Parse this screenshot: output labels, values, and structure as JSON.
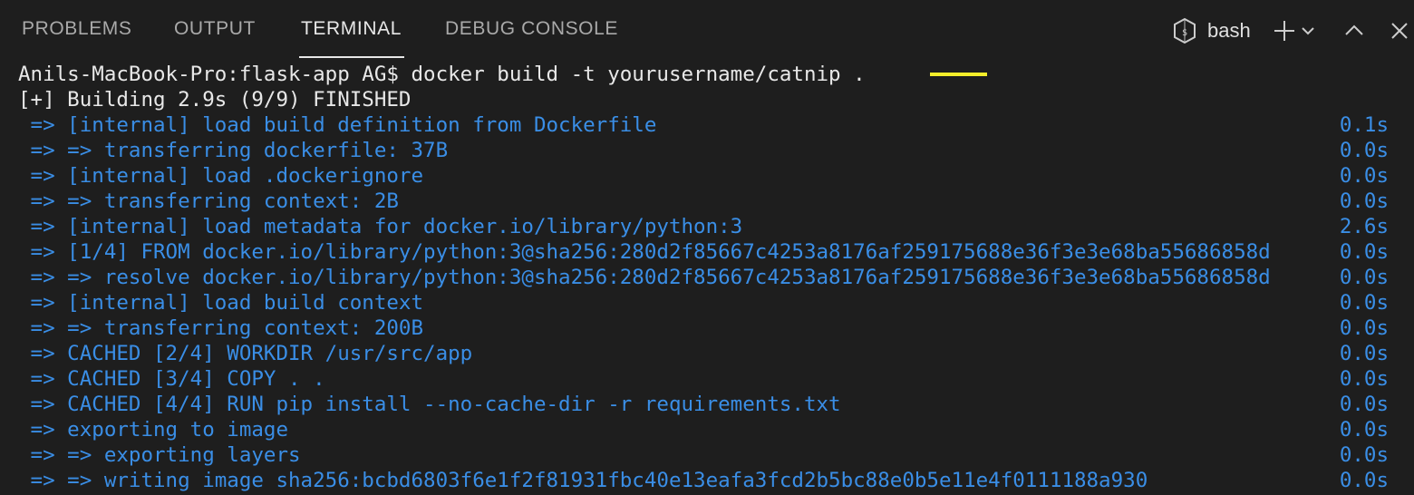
{
  "tabs": [
    {
      "label": "PROBLEMS"
    },
    {
      "label": "OUTPUT"
    },
    {
      "label": "TERMINAL"
    },
    {
      "label": "DEBUG CONSOLE"
    }
  ],
  "active_tab": "TERMINAL",
  "shell": {
    "label": "bash",
    "icon": "terminal-profile-icon"
  },
  "actions": {
    "new_terminal_icon": "plus-icon",
    "dropdown_icon": "chevron-down-icon",
    "maximize_icon": "chevron-up-icon",
    "close_icon": "close-icon"
  },
  "colors": {
    "background": "#1e1e1e",
    "text": "#e8e8e8",
    "build_step": "#3a8ee6",
    "cursor_highlight": "#f4ee2a"
  },
  "terminal": {
    "prompt_line": "Anils-MacBook-Pro:flask-app AG$ docker build -t yourusername/catnip .",
    "status_line": "[+] Building 2.9s (9/9) FINISHED",
    "steps": [
      {
        "text": " => [internal] load build definition from Dockerfile",
        "time": "0.1s"
      },
      {
        "text": " => => transferring dockerfile: 37B",
        "time": "0.0s"
      },
      {
        "text": " => [internal] load .dockerignore",
        "time": "0.0s"
      },
      {
        "text": " => => transferring context: 2B",
        "time": "0.0s"
      },
      {
        "text": " => [internal] load metadata for docker.io/library/python:3",
        "time": "2.6s"
      },
      {
        "text": " => [1/4] FROM docker.io/library/python:3@sha256:280d2f85667c4253a8176af259175688e36f3e3e68ba55686858d",
        "time": "0.0s"
      },
      {
        "text": " => => resolve docker.io/library/python:3@sha256:280d2f85667c4253a8176af259175688e36f3e3e68ba55686858d",
        "time": "0.0s"
      },
      {
        "text": " => [internal] load build context",
        "time": "0.0s"
      },
      {
        "text": " => => transferring context: 200B",
        "time": "0.0s"
      },
      {
        "text": " => CACHED [2/4] WORKDIR /usr/src/app",
        "time": "0.0s"
      },
      {
        "text": " => CACHED [3/4] COPY . .",
        "time": "0.0s"
      },
      {
        "text": " => CACHED [4/4] RUN pip install --no-cache-dir -r requirements.txt",
        "time": "0.0s"
      },
      {
        "text": " => exporting to image",
        "time": "0.0s"
      },
      {
        "text": " => => exporting layers",
        "time": "0.0s"
      },
      {
        "text": " => => writing image sha256:bcbd6803f6e1f2f81931fbc40e13eafa3fcd2b5bc88e0b5e11e4f0111188a930",
        "time": "0.0s"
      }
    ]
  }
}
